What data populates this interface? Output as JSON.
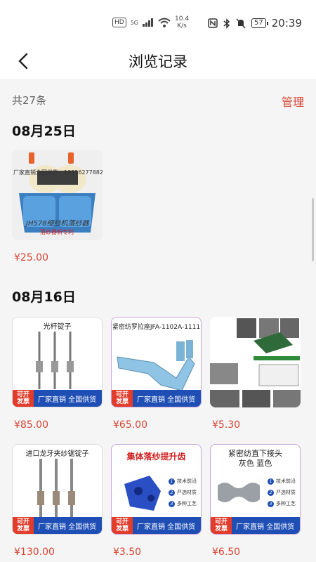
{
  "status": {
    "hd": "HD",
    "signal": "5G",
    "speed_value": "10.4",
    "speed_unit": "K/s",
    "battery": "57",
    "time": "20:39"
  },
  "nav": {
    "title": "浏览记录"
  },
  "summary": {
    "count_text": "共27条",
    "manage": "管理"
  },
  "groups": [
    {
      "date": "08月25日",
      "items": [
        {
          "price": "¥25.00",
          "overlay_phone": "厂家直销全国供货：18816277882",
          "overlay_name": "JH578细纱机落纱器",
          "overlay_sub": "落纱器新专利"
        }
      ]
    },
    {
      "date": "08月16日",
      "items": [
        {
          "price": "¥85.00",
          "caption": "光杆锭子",
          "badge_a": "可开",
          "badge_b": "发票",
          "badge_text": "厂家直销  全国供货"
        },
        {
          "price": "¥65.00",
          "caption": "紧密纺罗拉座JFA-1102A-1111",
          "badge_a": "可开",
          "badge_b": "发票",
          "badge_text": "厂家直销  全国供货"
        },
        {
          "price": "¥5.30"
        },
        {
          "price": "¥130.00",
          "caption": "进口龙牙夹纱锯锭子",
          "badge_a": "可开",
          "badge_b": "发票",
          "badge_text": "厂家直销  全国供货"
        },
        {
          "price": "¥3.50",
          "caption": "集体落纱提升齿",
          "bullets": [
            "技术前沿",
            "严选材质",
            "多种工艺"
          ],
          "badge_a": "可开",
          "badge_b": "发票",
          "badge_text": "厂家直销  全国供货"
        },
        {
          "price": "¥6.50",
          "caption": "紧密纺直下接头",
          "caption2": "灰色    蓝色",
          "bullets": [
            "技术前沿",
            "严选材质",
            "多种工艺"
          ],
          "badge_a": "可开",
          "badge_b": "发票",
          "badge_text": "厂家直销  全国供货"
        }
      ]
    }
  ]
}
